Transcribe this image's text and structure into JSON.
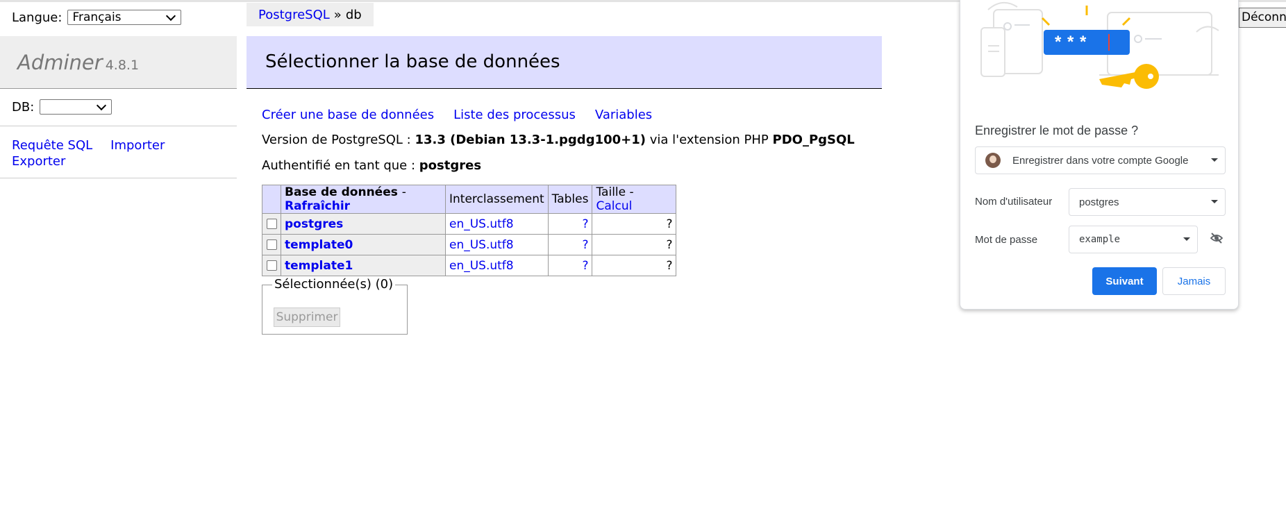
{
  "sidebar": {
    "language_label": "Langue:",
    "language_value": "Français",
    "app_name": "Adminer",
    "app_version": "4.8.1",
    "db_label": "DB:",
    "db_value": "",
    "links": [
      "Requête SQL",
      "Importer",
      "Exporter"
    ]
  },
  "breadcrumb": {
    "server": "PostgreSQL",
    "sep": "»",
    "current": "db"
  },
  "main": {
    "title": "Sélectionner la base de données",
    "actions": [
      "Créer une base de données",
      "Liste des processus",
      "Variables"
    ],
    "version_prefix": "Version de PostgreSQL :",
    "version_value": "13.3 (Debian 13.3-1.pgdg100+1)",
    "version_via": "via l'extension PHP",
    "version_ext": "PDO_PgSQL",
    "auth_prefix": "Authentifié en tant que :",
    "auth_user": "postgres"
  },
  "table": {
    "headers": {
      "name": "Base de données",
      "dash": "-",
      "refresh": "Rafraîchir",
      "collation": "Interclassement",
      "tables": "Tables",
      "size": "Taille",
      "calc": "Calcul"
    },
    "rows": [
      {
        "name": "postgres",
        "collation": "en_US.utf8",
        "tables": "?",
        "size": "?"
      },
      {
        "name": "template0",
        "collation": "en_US.utf8",
        "tables": "?",
        "size": "?"
      },
      {
        "name": "template1",
        "collation": "en_US.utf8",
        "tables": "?",
        "size": "?"
      }
    ]
  },
  "selection": {
    "legend": "Sélectionnée(s) (0)",
    "delete_label": "Supprimer"
  },
  "logout_label": "Déconnexion",
  "password_popup": {
    "title": "Enregistrer le mot de passe ?",
    "account_option": "Enregistrer dans votre compte Google",
    "username_label": "Nom d'utilisateur",
    "username_value": "postgres",
    "password_label": "Mot de passe",
    "password_value": "example",
    "masked_text": "* * *",
    "next_label": "Suivant",
    "never_label": "Jamais",
    "accent_color": "#1a73e8",
    "key_color": "#fbbc04"
  }
}
